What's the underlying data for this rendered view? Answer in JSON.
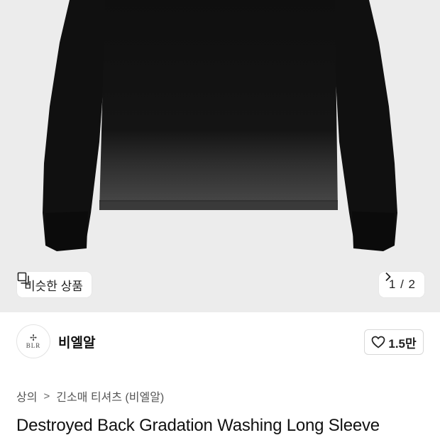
{
  "gallery": {
    "similar_label": "비슷한 상품",
    "page_indicator": "1 / 2",
    "image_index": 1,
    "image_total": 2
  },
  "brand": {
    "logo_text": "BLR",
    "name": "비엘알",
    "like_count": "1.5만"
  },
  "breadcrumb": {
    "category": "상의",
    "separator": ">",
    "subcategory": "긴소매 티셔츠 (비엘알)"
  },
  "product": {
    "title": "Destroyed Back Gradation Washing Long Sleeve"
  },
  "colors": {
    "hero_bg": "#ececec",
    "garment": "#0d0d0d",
    "garment_fade": "#4a4a4a"
  },
  "icons": {
    "similar": "stacked-squares-icon",
    "next": "chevron-right-icon",
    "like": "heart-outline-icon"
  }
}
